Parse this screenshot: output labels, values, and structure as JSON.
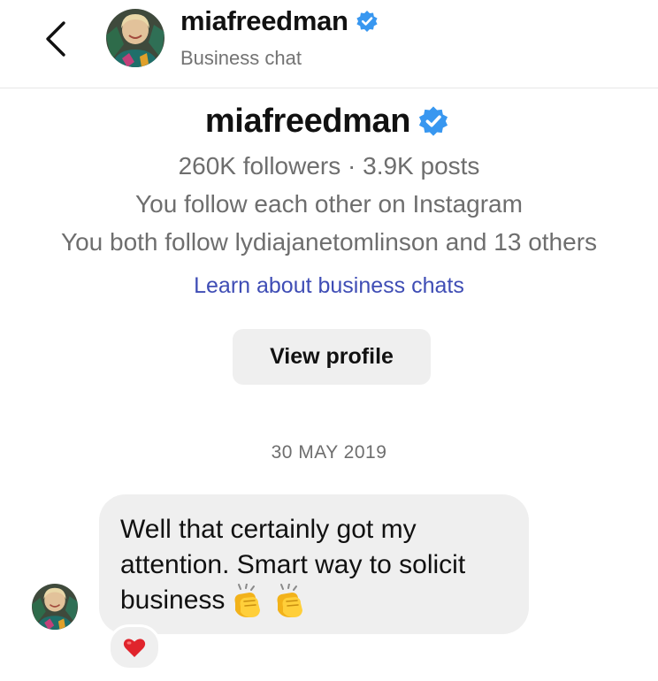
{
  "header": {
    "back_icon": "chevron-left-icon",
    "username": "miafreedman",
    "subtitle": "Business chat",
    "verified_icon": "verified-badge-icon",
    "verified_color": "#3897f0"
  },
  "profile": {
    "username": "miafreedman",
    "stats": "260K followers · 3.9K posts",
    "mutual": "You follow each other on Instagram",
    "mutual_followers": "You both follow lydiajanetomlinson and 13 others",
    "learn_link": "Learn about business chats",
    "view_profile_label": "View profile",
    "link_color": "#3f4db5"
  },
  "conversation": {
    "date": "30 MAY 2019",
    "messages": [
      {
        "sender": "miafreedman",
        "lines": [
          "Well that certainly got my",
          "attention. Smart way to solicit",
          "business"
        ],
        "emojis": [
          "clapping-hands-emoji",
          "clapping-hands-emoji"
        ],
        "reaction": "red-heart-icon"
      }
    ]
  }
}
